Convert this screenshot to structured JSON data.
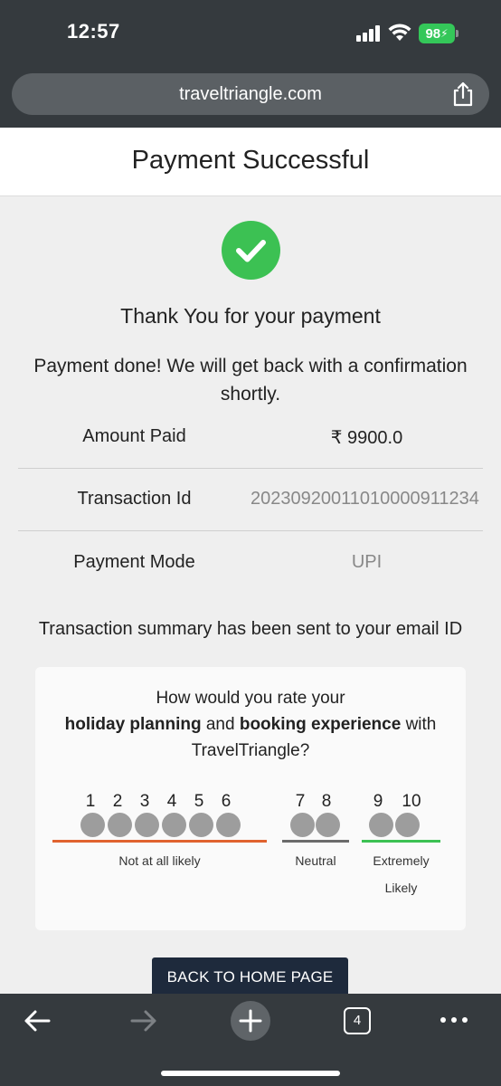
{
  "status_bar": {
    "time": "12:57",
    "battery": "98"
  },
  "browser": {
    "url": "traveltriangle.com",
    "tab_count": "4"
  },
  "page": {
    "title": "Payment Successful",
    "thanks": "Thank You for your payment",
    "message": "Payment done! We will get back with a confirmation shortly.",
    "details": [
      {
        "label": "Amount Paid",
        "value": "₹ 9900.0"
      },
      {
        "label": "Transaction Id",
        "value": "20230920011010000911234"
      },
      {
        "label": "Payment Mode",
        "value": "UPI"
      }
    ],
    "summary": "Transaction summary has been sent to your email ID"
  },
  "rating": {
    "question_line1": "How would you rate your",
    "question_bold1": "holiday planning",
    "question_and": " and ",
    "question_bold2": "booking experience",
    "question_with": " with",
    "question_line3": "TravelTriangle?",
    "scores": [
      "1",
      "2",
      "3",
      "4",
      "5",
      "6",
      "7",
      "8",
      "9",
      "10"
    ],
    "labels": {
      "low": "Not at all likely",
      "mid": "Neutral",
      "high_1": "Extremely",
      "high_2": "Likely"
    },
    "colors": {
      "low": "#e0622e",
      "mid": "#6b6b6b",
      "high": "#3cc153"
    }
  },
  "actions": {
    "back_home": "BACK TO HOME PAGE"
  }
}
